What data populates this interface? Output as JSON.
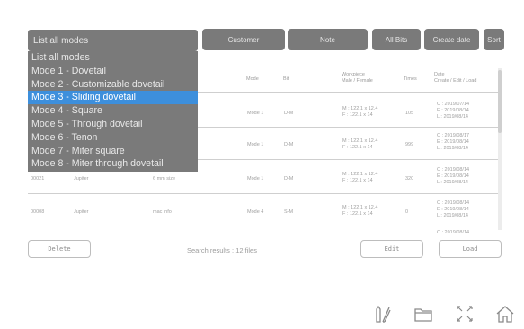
{
  "toolbar": {
    "filter_selected": "List all modes",
    "customer_label": "Customer",
    "note_label": "Note",
    "all_bits_label": "All Bits",
    "create_date_label": "Create date",
    "sort_label": "Sort"
  },
  "dropdown": {
    "options": [
      "List all modes",
      "Mode 1 - Dovetail",
      "Mode 2 - Customizable dovetail",
      "Mode 3 - Sliding dovetail",
      "Mode 4 - Square",
      "Mode 5 - Through dovetail",
      "Mode 6 - Tenon",
      "Mode 7 - Miter square",
      "Mode 8 - Miter through dovetail"
    ],
    "selected_index": 3
  },
  "table": {
    "headers": {
      "mode": "Mode",
      "bit": "Bit",
      "workpiece": "Workpiece",
      "workpiece_sub": "Male / Female",
      "times": "Times",
      "date": "Date",
      "date_sub": "Create / Edit / Load"
    },
    "rows": [
      {
        "id": "",
        "customer": "",
        "note": "",
        "mode": "Mode 1",
        "bit": "D-M",
        "wp_m": "M : 122.1 x 12.4",
        "wp_f": "F : 122.1 x 14",
        "times": "105",
        "date_c": "C : 2019/07/14",
        "date_e": "E : 2019/08/14",
        "date_l": "L : 2019/08/14"
      },
      {
        "id": "",
        "customer": "",
        "note": "",
        "mode": "Mode 1",
        "bit": "D-M",
        "wp_m": "M : 122.1 x 12.4",
        "wp_f": "F : 122.1 x 14",
        "times": "999",
        "date_c": "C : 2019/08/17",
        "date_e": "E : 2019/08/14",
        "date_l": "L : 2019/08/14"
      },
      {
        "id": "00021",
        "customer": "Jupiter",
        "note": "6 mm size",
        "mode": "Mode 1",
        "bit": "D-M",
        "wp_m": "M : 122.1 x 12.4",
        "wp_f": "F : 122.1 x 14",
        "times": "320",
        "date_c": "C : 2019/08/14",
        "date_e": "E : 2019/08/14",
        "date_l": "L : 2019/08/14"
      },
      {
        "id": "00008",
        "customer": "Jupiter",
        "note": "mac info",
        "mode": "Mode 4",
        "bit": "S-M",
        "wp_m": "M : 122.1 x 12.4",
        "wp_f": "F : 122.1 x 14",
        "times": "0",
        "date_c": "C : 2019/08/14",
        "date_e": "E : 2019/08/14",
        "date_l": "L : 2019/08/14"
      }
    ],
    "partial_row_date": "C : 2019/08/14"
  },
  "actions": {
    "delete_label": "Delete",
    "edit_label": "Edit",
    "load_label": "Load",
    "search_results": "Search results : 12 files"
  },
  "bottom_nav": {
    "icons": [
      "ruler-pencil-icon",
      "folder-icon",
      "fullscreen-icon",
      "home-icon"
    ]
  },
  "colors": {
    "button_bg": "#7a7a7a",
    "selected_option": "#3d8fdc",
    "border": "#bdbdbd"
  }
}
